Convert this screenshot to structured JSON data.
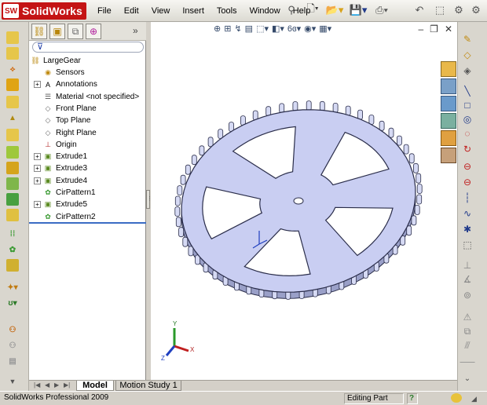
{
  "app": {
    "logo_text": "SolidWorks",
    "logo_badge": "SW"
  },
  "menu": [
    "File",
    "Edit",
    "View",
    "Insert",
    "Tools",
    "Window",
    "Help"
  ],
  "feature_tree": {
    "root": "LargeGear",
    "items": [
      {
        "label": "Sensors",
        "icon": "sensors-icon",
        "expandable": false
      },
      {
        "label": "Annotations",
        "icon": "annotations-icon",
        "expandable": true
      },
      {
        "label": "Material <not specified>",
        "icon": "material-icon",
        "expandable": false
      },
      {
        "label": "Front Plane",
        "icon": "plane-icon",
        "expandable": false
      },
      {
        "label": "Top Plane",
        "icon": "plane-icon",
        "expandable": false
      },
      {
        "label": "Right Plane",
        "icon": "plane-icon",
        "expandable": false
      },
      {
        "label": "Origin",
        "icon": "origin-icon",
        "expandable": false
      },
      {
        "label": "Extrude1",
        "icon": "extrude-icon",
        "expandable": true
      },
      {
        "label": "Extrude3",
        "icon": "extrude-icon",
        "expandable": true
      },
      {
        "label": "Extrude4",
        "icon": "extrude-icon",
        "expandable": true
      },
      {
        "label": "CirPattern1",
        "icon": "circular-pattern-icon",
        "expandable": false
      },
      {
        "label": "Extrude5",
        "icon": "extrude-icon",
        "expandable": true
      },
      {
        "label": "CirPattern2",
        "icon": "circular-pattern-icon",
        "expandable": false
      }
    ]
  },
  "bottom_tabs": {
    "model": "Model",
    "motion": "Motion Study 1"
  },
  "status": {
    "product": "SolidWorks Professional 2009",
    "mode": "Editing Part",
    "help": "?"
  },
  "colors": {
    "gear_fill": "#c9cef2",
    "gear_edge": "#2a2d4a",
    "selection_line": "#3a6cc4",
    "logo_red": "#c41414"
  },
  "axes": {
    "x": "X",
    "y": "Y",
    "z": "Z"
  }
}
